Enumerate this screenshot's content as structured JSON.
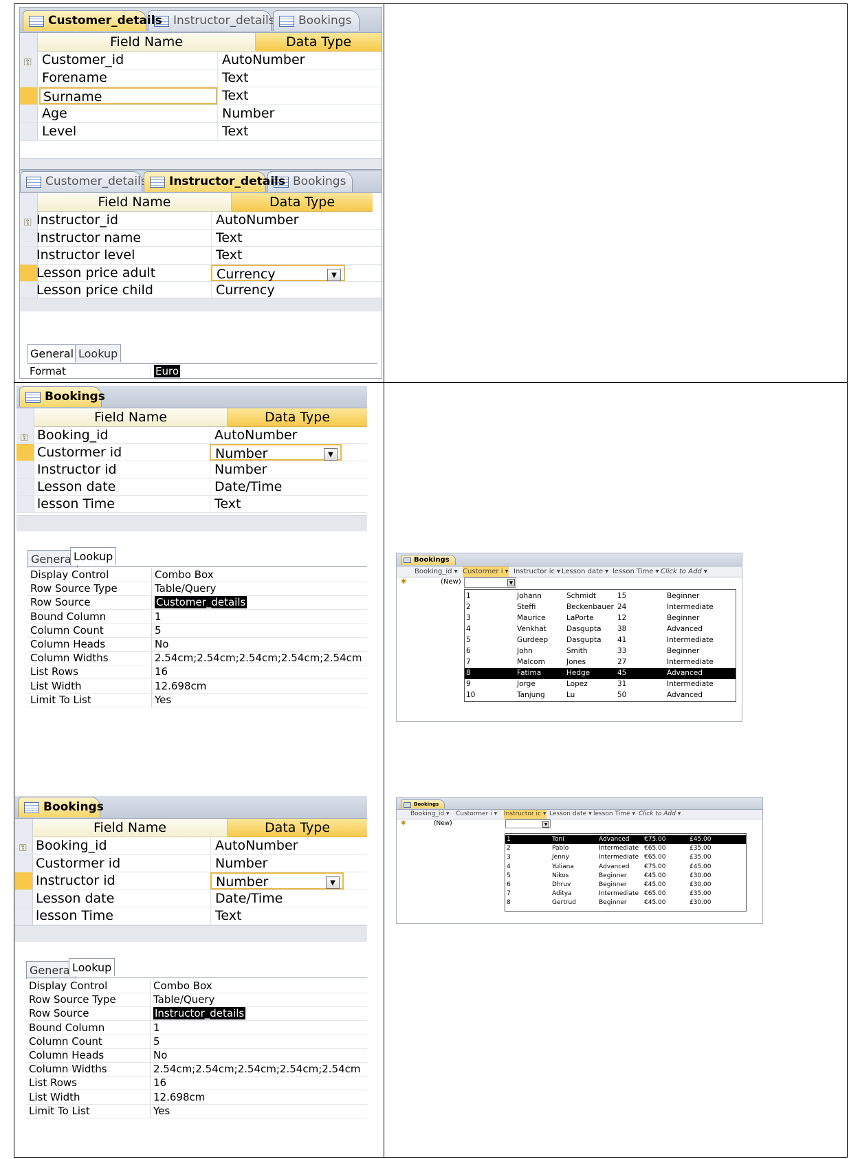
{
  "tabs": {
    "customer": "Customer_details",
    "instructor": "Instructor_details",
    "bookings": "Bookings"
  },
  "headers": {
    "field_name": "Field Name",
    "data_type": "Data Type"
  },
  "customer_fields": [
    {
      "name": "Customer_id",
      "type": "AutoNumber"
    },
    {
      "name": "Forename",
      "type": "Text"
    },
    {
      "name": "Surname",
      "type": "Text"
    },
    {
      "name": "Age",
      "type": "Number"
    },
    {
      "name": "Level",
      "type": "Text"
    }
  ],
  "instructor_fields": [
    {
      "name": "Instructor_id",
      "type": "AutoNumber"
    },
    {
      "name": "Instructor name",
      "type": "Text"
    },
    {
      "name": "Instructor level",
      "type": "Text"
    },
    {
      "name": "Lesson price adult",
      "type": "Currency"
    },
    {
      "name": "Lesson price child",
      "type": "Currency"
    }
  ],
  "instructor_props": {
    "general": "General",
    "lookup": "Lookup",
    "format_label": "Format",
    "format_value": "Euro"
  },
  "booking_fields": [
    {
      "name": "Booking_id",
      "type": "AutoNumber"
    },
    {
      "name": "Custormer id",
      "type": "Number"
    },
    {
      "name": "Instructor id",
      "type": "Number"
    },
    {
      "name": "Lesson date",
      "type": "Date/Time"
    },
    {
      "name": "lesson Time",
      "type": "Text"
    }
  ],
  "lookup_labels": [
    "Display Control",
    "Row Source Type",
    "Row Source",
    "Bound Column",
    "Column Count",
    "Column Heads",
    "Column Widths",
    "List Rows",
    "List Width",
    "Limit To List"
  ],
  "lookup_customer_values": [
    "Combo Box",
    "Table/Query",
    "Customer_details",
    "1",
    "5",
    "No",
    "2.54cm;2.54cm;2.54cm;2.54cm;2.54cm",
    "16",
    "12.698cm",
    "Yes"
  ],
  "lookup_instructor_values": [
    "Combo Box",
    "Table/Query",
    "Instructor_details",
    "1",
    "5",
    "No",
    "2.54cm;2.54cm;2.54cm;2.54cm;2.54cm",
    "16",
    "12.698cm",
    "Yes"
  ],
  "ds_headers": [
    "Booking_id",
    "Custormer i",
    "Instructor ic",
    "Lesson date",
    "lesson Time",
    "Click to Add"
  ],
  "ds_new": "(New)",
  "customer_combo": [
    [
      "1",
      "Johann",
      "Schmidt",
      "15",
      "Beginner"
    ],
    [
      "2",
      "Steffi",
      "Beckenbauer",
      "24",
      "Intermediate"
    ],
    [
      "3",
      "Maurice",
      "LaPorte",
      "12",
      "Beginner"
    ],
    [
      "4",
      "Venkhat",
      "Dasgupta",
      "38",
      "Advanced"
    ],
    [
      "5",
      "Gurdeep",
      "Dasgupta",
      "41",
      "Intermediate"
    ],
    [
      "6",
      "John",
      "Smith",
      "33",
      "Beginner"
    ],
    [
      "7",
      "Malcom",
      "Jones",
      "27",
      "Intermediate"
    ],
    [
      "8",
      "Fatima",
      "Hedge",
      "45",
      "Advanced"
    ],
    [
      "9",
      "Jorge",
      "Lopez",
      "31",
      "Intermediate"
    ],
    [
      "10",
      "Tanjung",
      "Lu",
      "50",
      "Advanced"
    ]
  ],
  "instructor_combo": [
    [
      "1",
      "Toni",
      "Advanced",
      "€75.00",
      "£45.00"
    ],
    [
      "2",
      "Pablo",
      "Intermediate",
      "€65.00",
      "£35.00"
    ],
    [
      "3",
      "Jenny",
      "Intermediate",
      "€65.00",
      "£35.00"
    ],
    [
      "4",
      "Yuliana",
      "Advanced",
      "€75.00",
      "£45.00"
    ],
    [
      "5",
      "Nikos",
      "Beginner",
      "€45.00",
      "£30.00"
    ],
    [
      "6",
      "Dhruv",
      "Beginner",
      "€45.00",
      "£30.00"
    ],
    [
      "7",
      "Aditya",
      "Intermediate",
      "€65.00",
      "£35.00"
    ],
    [
      "8",
      "Gertrud",
      "Beginner",
      "€45.00",
      "£30.00"
    ]
  ],
  "colors": {
    "active_tab": "#f7d66a",
    "current_row": "#f7c84a",
    "highlight": "#000000"
  }
}
